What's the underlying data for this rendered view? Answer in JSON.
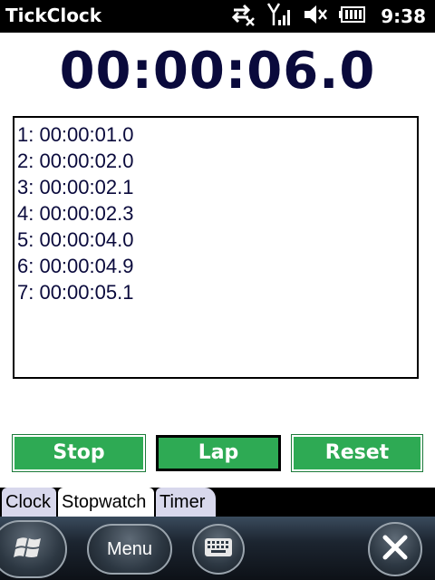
{
  "statusbar": {
    "app_title": "TickClock",
    "time": "9:38",
    "icons": [
      "connectivity-icon",
      "signal-icon",
      "volume-muted-icon",
      "battery-icon"
    ]
  },
  "stopwatch": {
    "display": "00:00:06.0",
    "laps": [
      "1: 00:00:01.0",
      "2: 00:00:02.0",
      "3: 00:00:02.1",
      "4: 00:00:02.3",
      "5: 00:00:04.0",
      "6: 00:00:04.9",
      "7: 00:00:05.1"
    ]
  },
  "buttons": {
    "stop": "Stop",
    "lap": "Lap",
    "reset": "Reset"
  },
  "tabs": [
    {
      "label": "Clock",
      "active": false
    },
    {
      "label": "Stopwatch",
      "active": true
    },
    {
      "label": "Timer",
      "active": false
    }
  ],
  "softbar": {
    "menu_label": "Menu",
    "icons": [
      "windows-start-icon",
      "keyboard-icon",
      "close-icon"
    ]
  },
  "colors": {
    "button_green": "#2eaa54",
    "time_text": "#0a0a3c",
    "tab_inactive": "#d8d8ec"
  }
}
